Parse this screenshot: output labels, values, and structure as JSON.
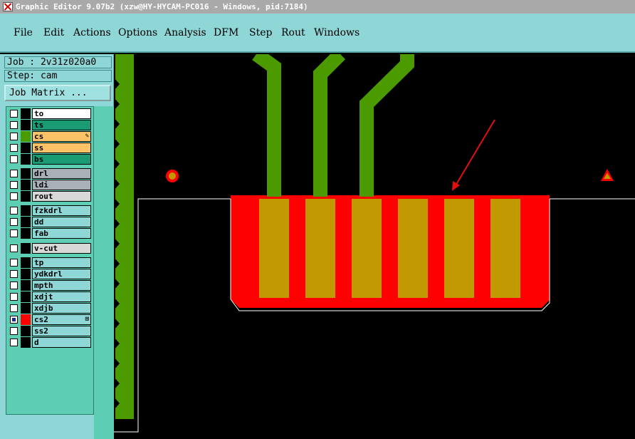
{
  "window": {
    "title": "Graphic Editor 9.07b2 (xzw@HY-HYCAM-PC016 - Windows, pid:7184)"
  },
  "menu": [
    {
      "label": "File"
    },
    {
      "label": "Edit"
    },
    {
      "label": "Actions"
    },
    {
      "label": "Options"
    },
    {
      "label": "Analysis"
    },
    {
      "label": "DFM"
    },
    {
      "label": "Step"
    },
    {
      "label": "Rout"
    },
    {
      "label": "Windows"
    }
  ],
  "job": {
    "job_label": "Job : 2v31z020a0",
    "step_label": "Step: cam",
    "matrix_button": "Job Matrix ..."
  },
  "layers": [
    {
      "name": "to",
      "color": "#ffffff",
      "swatch": "#000000",
      "checked": false
    },
    {
      "name": "ts",
      "color": "#1a9b74",
      "swatch": "#000000",
      "checked": false
    },
    {
      "name": "cs",
      "color": "#ffc266",
      "swatch": "#4a9a00",
      "checked": false,
      "marker": "pencil-icon"
    },
    {
      "name": "ss",
      "color": "#ffc266",
      "swatch": "#000000",
      "checked": false
    },
    {
      "name": "bs",
      "color": "#1a9b74",
      "swatch": "#000000",
      "checked": false
    },
    {
      "name": "drl",
      "color": "#a9b0b8",
      "swatch": "#000000",
      "checked": false
    },
    {
      "name": "ldi",
      "color": "#a9b0b8",
      "swatch": "#000000",
      "checked": false
    },
    {
      "name": "rout",
      "color": "#d8d8d8",
      "swatch": "#000000",
      "checked": false
    },
    {
      "name": "fzkdrl",
      "color": "#8fd6d6",
      "swatch": "#000000",
      "checked": false
    },
    {
      "name": "dd",
      "color": "#8fd6d6",
      "swatch": "#000000",
      "checked": false
    },
    {
      "name": "fab",
      "color": "#8fd6d6",
      "swatch": "#000000",
      "checked": false
    },
    {
      "name": "v-cut",
      "color": "#d8d8d8",
      "swatch": "#000000",
      "checked": false
    },
    {
      "name": "tp",
      "color": "#8fd6d6",
      "swatch": "#000000",
      "checked": false
    },
    {
      "name": "ydkdrl",
      "color": "#8fd6d6",
      "swatch": "#000000",
      "checked": false
    },
    {
      "name": "mpth",
      "color": "#8fd6d6",
      "swatch": "#000000",
      "checked": false
    },
    {
      "name": "xdjt",
      "color": "#8fd6d6",
      "swatch": "#000000",
      "checked": false
    },
    {
      "name": "xdjb",
      "color": "#8fd6d6",
      "swatch": "#000000",
      "checked": false
    },
    {
      "name": "cs2",
      "color": "#8fd6d6",
      "swatch": "#ff0000",
      "checked": true,
      "marker": "plus-box-icon"
    },
    {
      "name": "ss2",
      "color": "#8fd6d6",
      "swatch": "#000000",
      "checked": false
    },
    {
      "name": "d",
      "color": "#8fd6d6",
      "swatch": "#000000",
      "checked": false
    }
  ],
  "colors": {
    "trace_green": "#4a9a00",
    "pad_gold": "#c09a00",
    "solder_red": "#ff0000",
    "arrow_red": "#e01010",
    "outline_white": "#ffffff",
    "panel_cyan": "#8fd6d6"
  }
}
